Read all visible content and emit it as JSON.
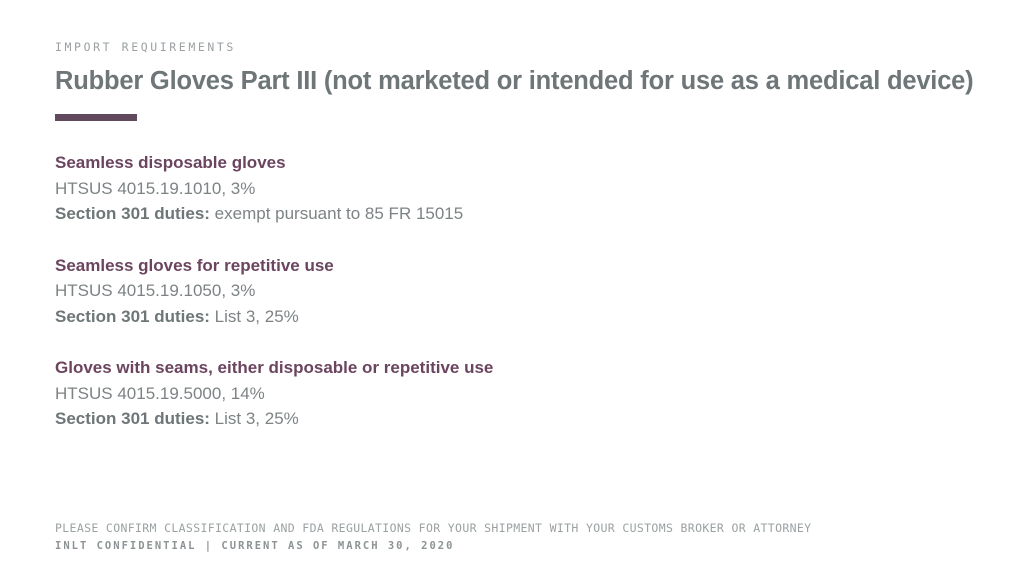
{
  "theme": {
    "background": "#ffffff",
    "accent_plum": "#624a5e",
    "heading_plum": "#6b455f",
    "title_grey": "#6e7678",
    "body_grey": "#7d8385",
    "muted_grey": "#9ba1a3"
  },
  "header": {
    "eyebrow": "IMPORT REQUIREMENTS",
    "title": "Rubber Gloves Part III (not marketed or intended for use as a medical device)"
  },
  "entries": [
    {
      "title": "Seamless disposable gloves",
      "code": "HTSUS 4015.19.1010, 3%",
      "duties_label": "Section 301 duties:",
      "duties_value": "exempt pursuant to 85 FR 15015"
    },
    {
      "title": "Seamless gloves for repetitive use",
      "code": "HTSUS 4015.19.1050, 3%",
      "duties_label": "Section 301 duties:",
      "duties_value": "List 3, 25%"
    },
    {
      "title": "Gloves with seams, either disposable or repetitive use",
      "code": "HTSUS 4015.19.5000, 14%",
      "duties_label": "Section 301 duties:",
      "duties_value": "List 3, 25%"
    }
  ],
  "footer": {
    "disclaimer": "PLEASE CONFIRM CLASSIFICATION AND FDA REGULATIONS FOR YOUR SHIPMENT WITH YOUR CUSTOMS BROKER OR ATTORNEY",
    "confidential": "INLT CONFIDENTIAL  |  CURRENT AS OF MARCH 30, 2020"
  }
}
